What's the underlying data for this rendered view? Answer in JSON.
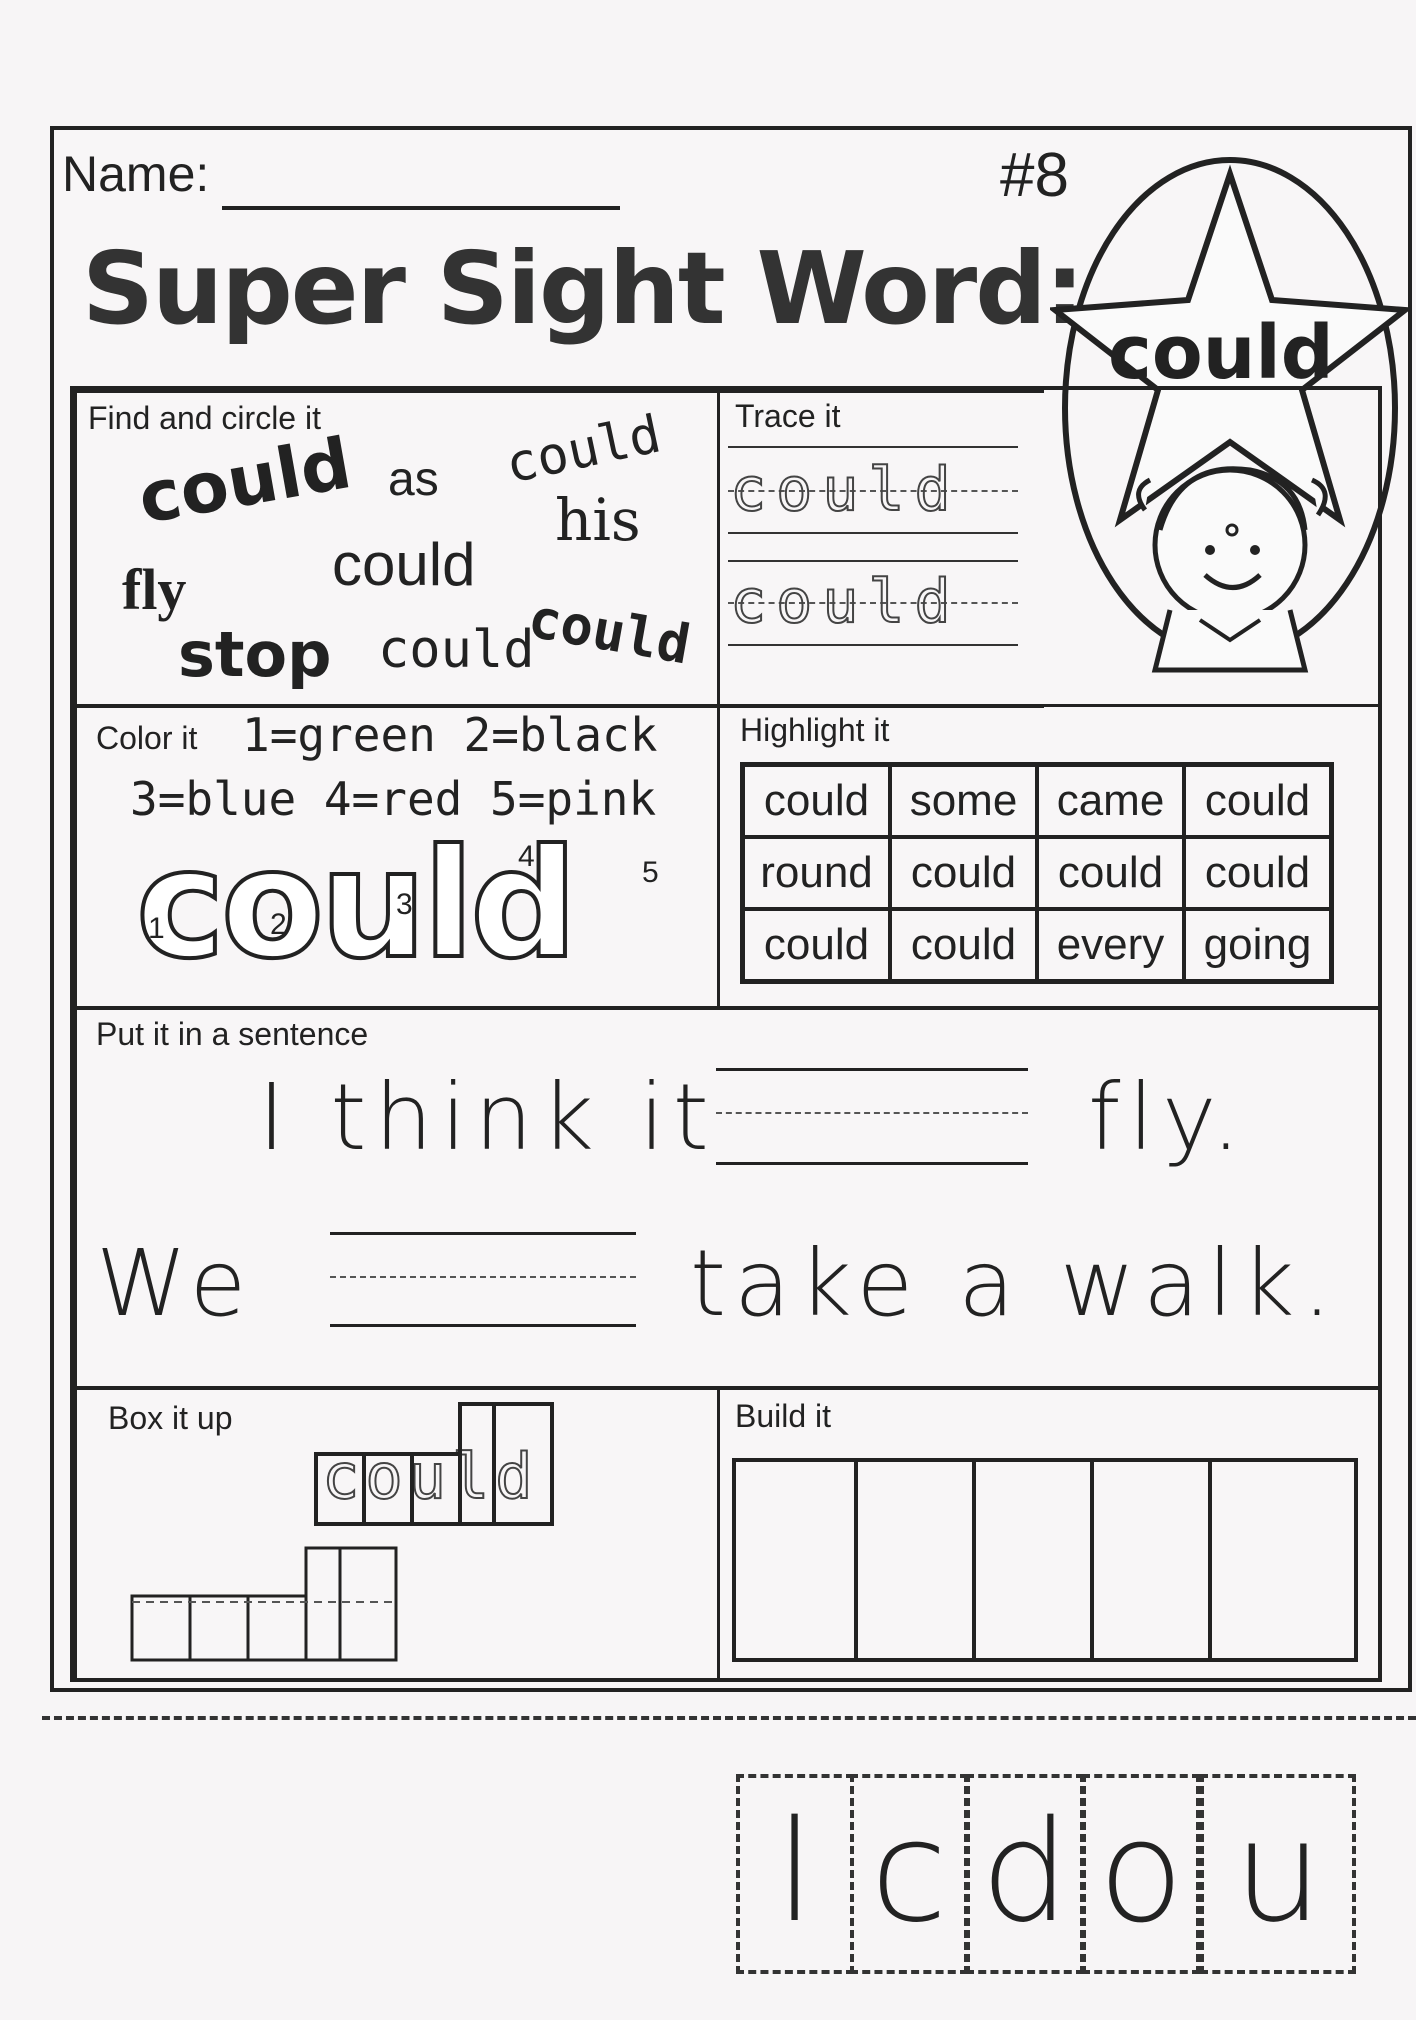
{
  "header": {
    "name_label": "Name:",
    "number": "#8",
    "title": "Super Sight Word:",
    "star_word": "could"
  },
  "find": {
    "label": "Find and circle it",
    "words": [
      "could",
      "as",
      "could",
      "his",
      "fly",
      "could",
      "stop",
      "could",
      "could"
    ]
  },
  "trace": {
    "label": "Trace it",
    "word": "could"
  },
  "color": {
    "label": "Color it",
    "key_line1": "1=green 2=black",
    "key_line2": "3=blue 4=red 5=pink",
    "word": "could",
    "numbers": [
      "1",
      "2",
      "3",
      "4",
      "5"
    ]
  },
  "highlight": {
    "label": "Highlight it",
    "rows": [
      [
        "could",
        "some",
        "came",
        "could"
      ],
      [
        "round",
        "could",
        "could",
        "could"
      ],
      [
        "could",
        "could",
        "every",
        "going"
      ]
    ]
  },
  "sentence": {
    "label": "Put it in a sentence",
    "s1_before": "I think it",
    "s1_after": "fly.",
    "s2_before": "We",
    "s2_after": "take a walk."
  },
  "boxit": {
    "label": "Box it up",
    "word": "could"
  },
  "build": {
    "label": "Build it",
    "box_count": 5
  },
  "tiles": [
    "l",
    "c",
    "d",
    "o",
    "u"
  ]
}
